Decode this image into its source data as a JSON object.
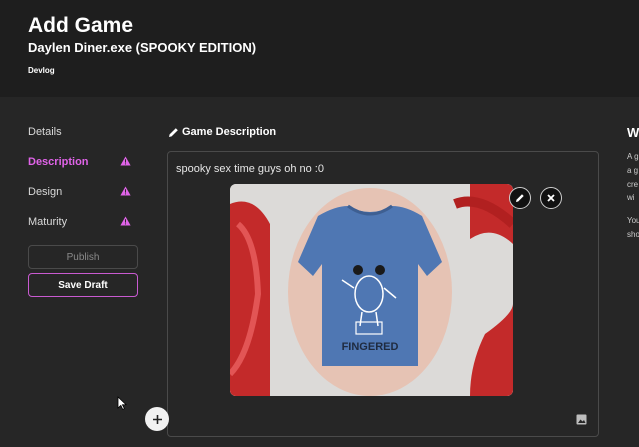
{
  "header": {
    "title": "Add Game",
    "game_name": "Daylen Diner.exe (SPOOKY EDITION)",
    "tag": "Devlog"
  },
  "sidebar": {
    "items": [
      {
        "label": "Details",
        "warning": false
      },
      {
        "label": "Description",
        "warning": true,
        "active": true
      },
      {
        "label": "Design",
        "warning": true
      },
      {
        "label": "Maturity",
        "warning": true
      }
    ],
    "publish_label": "Publish",
    "save_draft_label": "Save Draft"
  },
  "main": {
    "section_title": "Game Description",
    "description_text": "spooky sex time guys oh no :0",
    "image": {
      "shirt_text": "FINGERED"
    }
  },
  "right_panel": {
    "heading": "W",
    "lines": [
      "A g",
      "a g",
      "cre",
      "wi",
      "You",
      "sho"
    ]
  },
  "colors": {
    "accent": "#e063e8",
    "background": "#262626",
    "header_background": "#1e1e1e"
  },
  "icons": [
    "warning-icon",
    "pencil-icon",
    "close-icon",
    "image-icon",
    "plus-icon",
    "mouse-cursor-icon"
  ]
}
